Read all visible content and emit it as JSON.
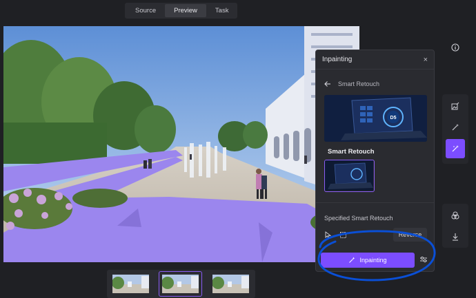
{
  "tabs": [
    {
      "label": "Source",
      "active": false
    },
    {
      "label": "Preview",
      "active": true
    },
    {
      "label": "Task",
      "active": false
    }
  ],
  "toolbar": {
    "info_icon": "info-icon",
    "group1": [
      "image-edit-icon",
      "magic-wand-icon",
      "magic-wand-sparkle-icon"
    ],
    "active_tool": "magic-wand-sparkle-icon",
    "group2": [
      "color-circles-icon",
      "download-icon"
    ]
  },
  "panel": {
    "title": "Inpainting",
    "close": "×",
    "back_label": "Smart Retouch",
    "hero_badge": "D5",
    "hero_title": "Smart Retouch",
    "specified_label": "Specified Smart Retouch",
    "reverse_label": "Reverse",
    "inpaint_button": "Inpainting"
  },
  "colors": {
    "accent": "#7c4dff",
    "annotation": "#0a4fd6",
    "mask": "#9b86ee"
  },
  "thumbnails": {
    "count": 3,
    "selected": 2
  }
}
